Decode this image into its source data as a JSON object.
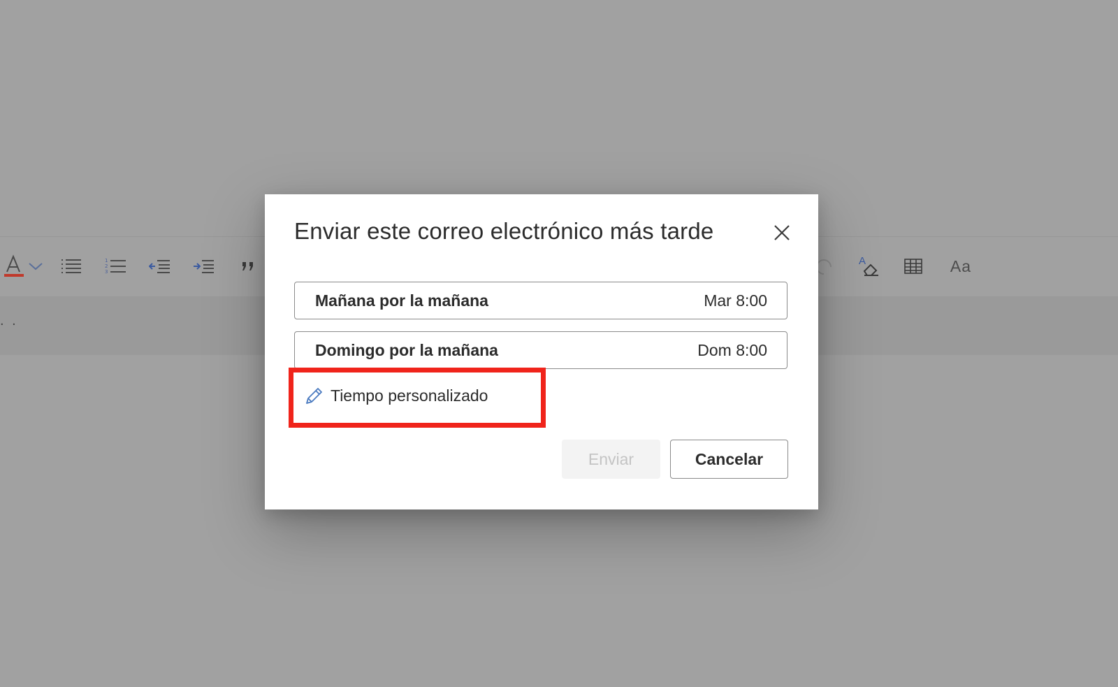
{
  "toolbar": {
    "buttons": [
      {
        "icon": "font-color-icon"
      },
      {
        "icon": "chevron-down-icon"
      },
      {
        "icon": "bullets-icon"
      },
      {
        "icon": "numbering-icon"
      },
      {
        "icon": "decrease-indent-icon"
      },
      {
        "icon": "increase-indent-icon"
      },
      {
        "icon": "quote-icon"
      },
      {
        "icon": "redo-icon"
      },
      {
        "icon": "clear-formatting-icon"
      },
      {
        "icon": "table-icon"
      },
      {
        "icon": "more-formatting-icon"
      }
    ],
    "font_size_label": "Aa",
    "accent_font_color": "#c0392b"
  },
  "subject": {
    "value": ". ."
  },
  "dialog": {
    "title": "Enviar este correo electrónico más tarde",
    "options": [
      {
        "label": "Mañana por la mañana",
        "time": "Mar 8:00"
      },
      {
        "label": "Domingo por la mañana",
        "time": "Dom 8:00"
      }
    ],
    "custom_time_label": "Tiempo personalizado",
    "send_label": "Enviar",
    "cancel_label": "Cancelar",
    "send_enabled": false
  },
  "annotation": {
    "highlight_color": "#f0241b",
    "target": "custom-time-option"
  }
}
